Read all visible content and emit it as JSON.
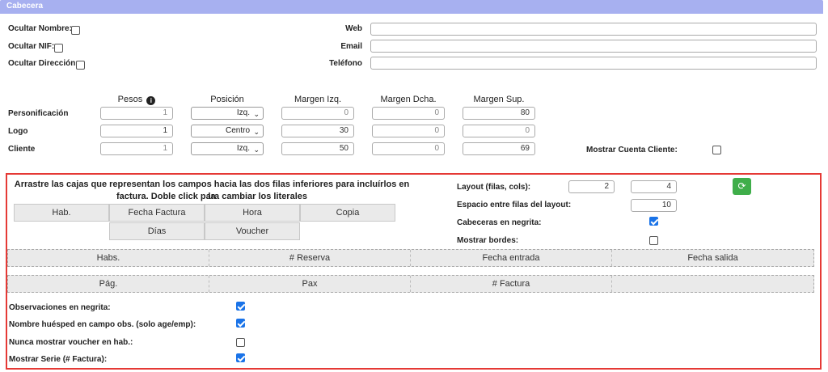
{
  "section": {
    "title": "Cabecera"
  },
  "top": {
    "ocultar_nombre": "Ocultar Nombre:",
    "ocultar_nif": "Ocultar NIF:",
    "ocultar_direccion": "Ocultar Dirección:",
    "web": "Web",
    "email": "Email",
    "telefono": "Teléfono"
  },
  "grid": {
    "headers": {
      "pesos": "Pesos",
      "posicion": "Posición",
      "margen_izq": "Margen Izq.",
      "margen_dcha": "Margen Dcha.",
      "margen_sup": "Margen Sup."
    },
    "rows": [
      {
        "label": "Personificación",
        "peso": "1",
        "posicion": "Izq.",
        "izq": "0",
        "dcha": "0",
        "sup": "80"
      },
      {
        "label": "Logo",
        "peso": "1",
        "posicion": "Centro",
        "izq": "30",
        "dcha": "0",
        "sup": "0"
      },
      {
        "label": "Cliente",
        "peso": "1",
        "posicion": "Izq.",
        "izq": "50",
        "dcha": "0",
        "sup": "69"
      }
    ],
    "mostrar_cuenta": "Mostrar Cuenta Cliente:"
  },
  "layout": {
    "instruction_line1": "Arrastre las cajas que representan los campos hacia las dos filas inferiores para incluírlos en la",
    "instruction_line2": "factura. Doble click para cambiar los literales",
    "boxes_row1": [
      "Hab.",
      "Fecha Factura",
      "Hora",
      "Copia"
    ],
    "boxes_row2": [
      "Días",
      "Voucher"
    ],
    "layout_label": "Layout (filas, cols):",
    "layout_rows": "2",
    "layout_cols": "4",
    "espacio_label": "Espacio entre filas del layout:",
    "espacio_value": "10",
    "cabeceras_label": "Cabeceras en negrita:",
    "bordes_label": "Mostrar bordes:",
    "row1_cells": [
      "Habs.",
      "# Reserva",
      "Fecha entrada",
      "Fecha salida"
    ],
    "row2_cells": [
      "Pág.",
      "Pax",
      "# Factura",
      ""
    ]
  },
  "options": {
    "obs_negrita": "Observaciones en negrita:",
    "nombre_huesped": "Nombre huésped en campo obs. (solo age/emp):",
    "nunca_voucher": "Nunca mostrar voucher en hab.:",
    "mostrar_serie": "Mostrar Serie (# Factura):"
  },
  "colors": {
    "header": "#a7b0f0",
    "red_border": "#e53935",
    "checkbox": "#1a73e8",
    "refresh": "#3fae4a"
  }
}
